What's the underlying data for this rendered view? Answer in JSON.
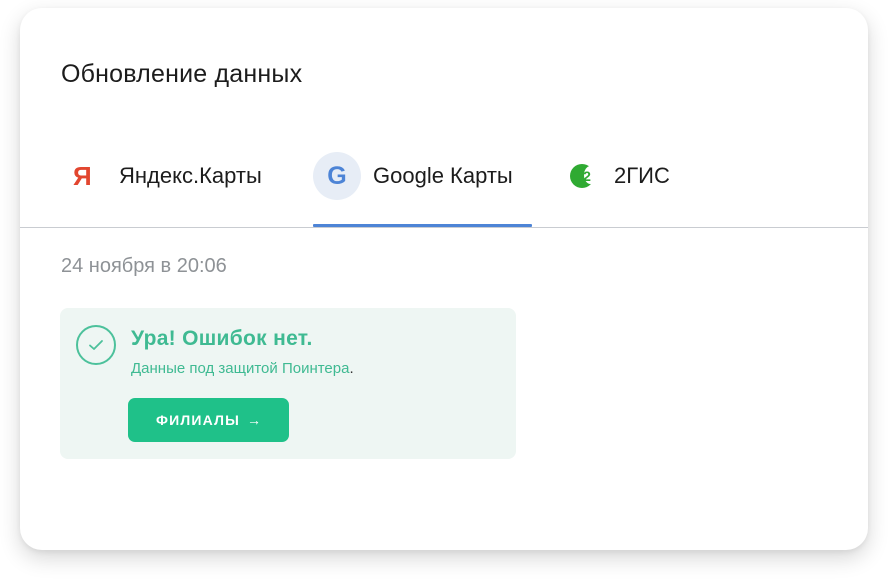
{
  "panel": {
    "title": "Обновление данных"
  },
  "tabs": [
    {
      "label": "Яндекс.Карты",
      "icon": "yandex-icon",
      "icon_glyph": "Я",
      "icon_color": "#e2462f",
      "active": false
    },
    {
      "label": "Google Карты",
      "icon": "google-icon",
      "icon_glyph": "G",
      "icon_color": "#4d84d6",
      "active": true
    },
    {
      "label": "2ГИС",
      "icon": "2gis-icon",
      "icon_glyph": "2",
      "icon_color": "#2faa32",
      "active": false
    }
  ],
  "last_update": "24 ноября в 20:06",
  "status": {
    "title": "Ура! Ошибок нет.",
    "subtitle_main": "Данные под защитой Поинтера",
    "subtitle_end": ".",
    "button_label": "ФИЛИАЛЫ",
    "button_arrow": "→",
    "icon": "check-circle-icon"
  },
  "colors": {
    "accent_blue": "#4d84d6",
    "success_green": "#3fba92",
    "button_green": "#1fc189",
    "status_bg": "#eef6f3"
  }
}
